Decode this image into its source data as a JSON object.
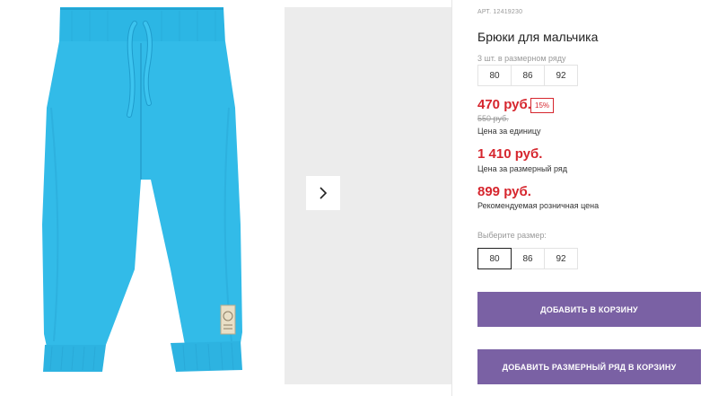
{
  "product": {
    "article": "АРТ. 12419230",
    "title": "Брюки для мальчика",
    "pack_label": "3 шт. в размерном ряду",
    "pack_sizes": [
      "80",
      "86",
      "92"
    ],
    "price": "470 руб.",
    "discount": "15%",
    "old_price": "550 руб.",
    "unit_price_caption": "Цена за единицу",
    "pack_price": "1 410 руб.",
    "pack_price_caption": "Цена за размерный ряд",
    "retail_price": "899 руб.",
    "retail_price_caption": "Рекомендуемая розничная цена"
  },
  "size_select": {
    "label": "Выберите размер:",
    "options": [
      "80",
      "86",
      "92"
    ],
    "selected": "80"
  },
  "buttons": {
    "add_to_cart": "Добавить в корзину",
    "add_pack_to_cart": "Добавить размерный ряд в корзину"
  },
  "gallery": {
    "next_icon": "chevron-right-icon"
  },
  "colors": {
    "price_red": "#d6262e",
    "button_purple": "#7a61a4",
    "pants_blue": "#2fb8e6"
  }
}
